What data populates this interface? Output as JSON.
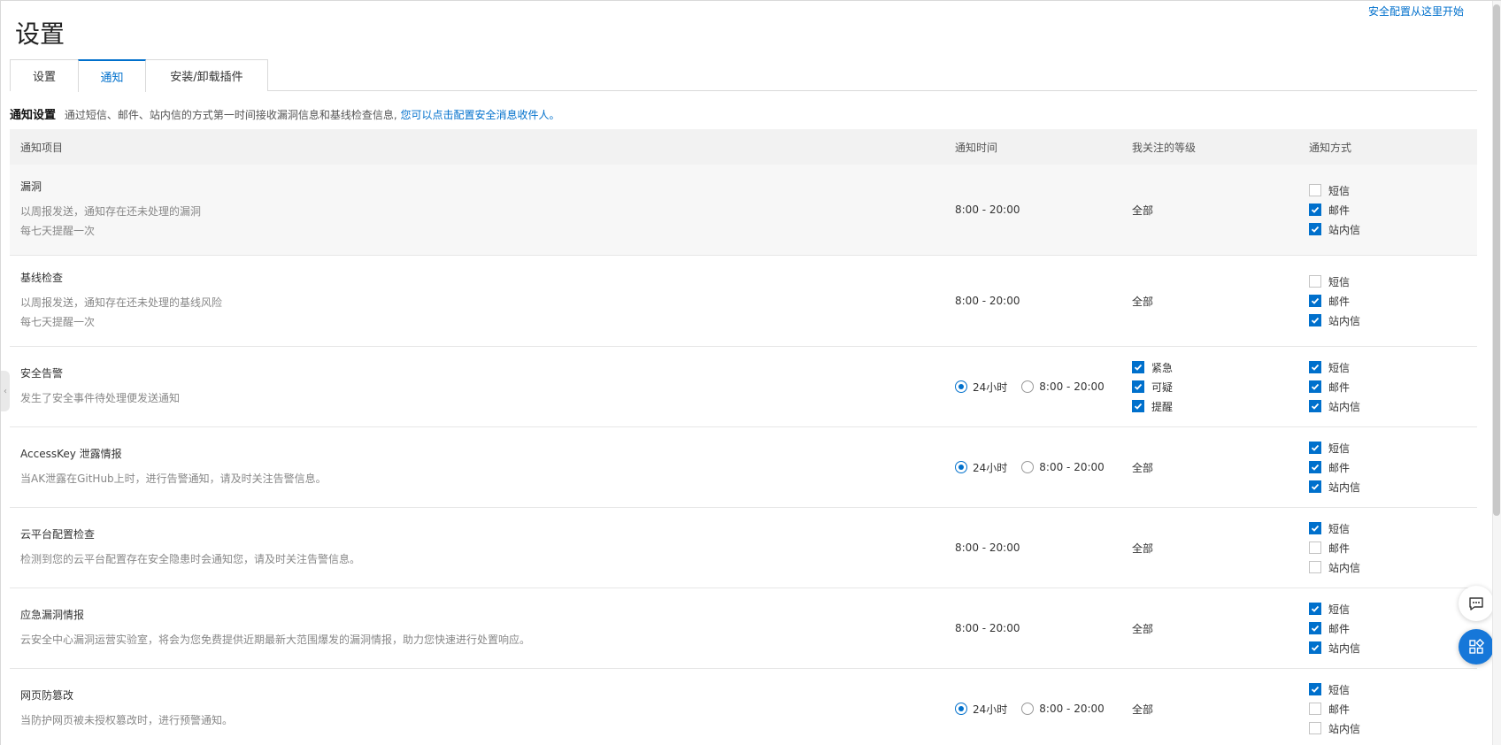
{
  "top_link": "安全配置从这里开始",
  "page_title": "设置",
  "tabs": [
    {
      "label": "设置",
      "active": false
    },
    {
      "label": "通知",
      "active": true
    },
    {
      "label": "安装/卸载插件",
      "active": false
    }
  ],
  "section": {
    "title": "通知设置",
    "desc": "通过短信、邮件、站内信的方式第一时间接收漏洞信息和基线检查信息,",
    "link": "您可以点击配置安全消息收件人。"
  },
  "columns": {
    "item": "通知项目",
    "time": "通知时间",
    "level": "我关注的等级",
    "method": "通知方式"
  },
  "methods_labels": [
    "短信",
    "邮件",
    "站内信"
  ],
  "rows": [
    {
      "title": "漏洞",
      "desc": [
        "以周报发送，通知存在还未处理的漏洞",
        "每七天提醒一次"
      ],
      "time_text": "8:00 - 20:00",
      "level_text": "全部",
      "methods": [
        false,
        true,
        true
      ]
    },
    {
      "title": "基线检查",
      "desc": [
        "以周报发送，通知存在还未处理的基线风险",
        "每七天提醒一次"
      ],
      "time_text": "8:00 - 20:00",
      "level_text": "全部",
      "methods": [
        false,
        true,
        true
      ]
    },
    {
      "title": "安全告警",
      "desc": [
        "发生了安全事件待处理便发送通知"
      ],
      "radio": [
        "24小时",
        "8:00 - 20:00"
      ],
      "radio_selected": 0,
      "levels": [
        {
          "label": "紧急",
          "checked": true
        },
        {
          "label": "可疑",
          "checked": true
        },
        {
          "label": "提醒",
          "checked": true
        }
      ],
      "methods": [
        true,
        true,
        true
      ]
    },
    {
      "title": "AccessKey 泄露情报",
      "desc": [
        "当AK泄露在GitHub上时，进行告警通知，请及时关注告警信息。"
      ],
      "radio": [
        "24小时",
        "8:00 - 20:00"
      ],
      "radio_selected": 0,
      "level_text": "全部",
      "methods": [
        true,
        true,
        true
      ]
    },
    {
      "title": "云平台配置检查",
      "desc": [
        "检测到您的云平台配置存在安全隐患时会通知您，请及时关注告警信息。"
      ],
      "time_text": "8:00 - 20:00",
      "level_text": "全部",
      "methods": [
        true,
        false,
        false
      ]
    },
    {
      "title": "应急漏洞情报",
      "desc": [
        "云安全中心漏洞运营实验室，将会为您免费提供近期最新大范围爆发的漏洞情报，助力您快速进行处置响应。"
      ],
      "time_text": "8:00 - 20:00",
      "level_text": "全部",
      "methods": [
        true,
        true,
        true
      ]
    },
    {
      "title": "网页防篡改",
      "desc": [
        "当防护网页被未授权篡改时，进行预警通知。"
      ],
      "radio": [
        "24小时",
        "8:00 - 20:00"
      ],
      "radio_selected": 0,
      "level_text": "全部",
      "methods": [
        true,
        false,
        false
      ]
    }
  ],
  "colors": {
    "accent": "#0070cc",
    "float_apps": "#1677d9"
  },
  "icons": {
    "chat": "chat-bubble-icon",
    "apps": "apps-grid-icon",
    "handle": "chevron-left-icon"
  }
}
